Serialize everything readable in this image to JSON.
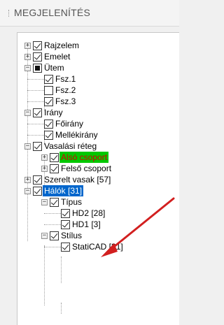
{
  "panel": {
    "title": "MEGJELENÍTÉS"
  },
  "tree": [
    {
      "label": "Rajzelem",
      "checked": true,
      "expander": "+"
    },
    {
      "label": "Emelet",
      "checked": true,
      "expander": "+"
    },
    {
      "label": "Ütem",
      "checked": "partial",
      "expander": "-"
    },
    {
      "label": "Fsz.1",
      "checked": true
    },
    {
      "label": "Fsz.2",
      "checked": false
    },
    {
      "label": "Fsz.3",
      "checked": true
    },
    {
      "label": "Irány",
      "checked": true,
      "expander": "-"
    },
    {
      "label": "Főirány",
      "checked": true
    },
    {
      "label": "Mellékirány",
      "checked": true
    },
    {
      "label": "Vasalási réteg",
      "checked": true,
      "expander": "-"
    },
    {
      "label": "Alsó csoport",
      "checked": true,
      "expander": "+"
    },
    {
      "label": "Felső csoport",
      "checked": true,
      "expander": "+"
    },
    {
      "label": "Szerelt vasak [57]",
      "checked": true,
      "expander": "+"
    },
    {
      "label": "Hálók [31]",
      "checked": true,
      "expander": "-"
    },
    {
      "label": "Típus",
      "checked": true,
      "expander": "-"
    },
    {
      "label": "HD2 [28]",
      "checked": true
    },
    {
      "label": "HD1 [3]",
      "checked": true
    },
    {
      "label": "Stílus",
      "checked": true,
      "expander": "-"
    },
    {
      "label": "StatiCAD [31]",
      "checked": true
    }
  ],
  "colors": {
    "green_highlight": "#00c800",
    "green_text": "#d40000",
    "blue_highlight": "#0066cc",
    "arrow": "#d21f1f"
  },
  "icons": {
    "expand": "plus-box-icon",
    "collapse": "minus-box-icon",
    "checkbox": "checkbox-icon",
    "arrow": "red-arrow-icon"
  }
}
